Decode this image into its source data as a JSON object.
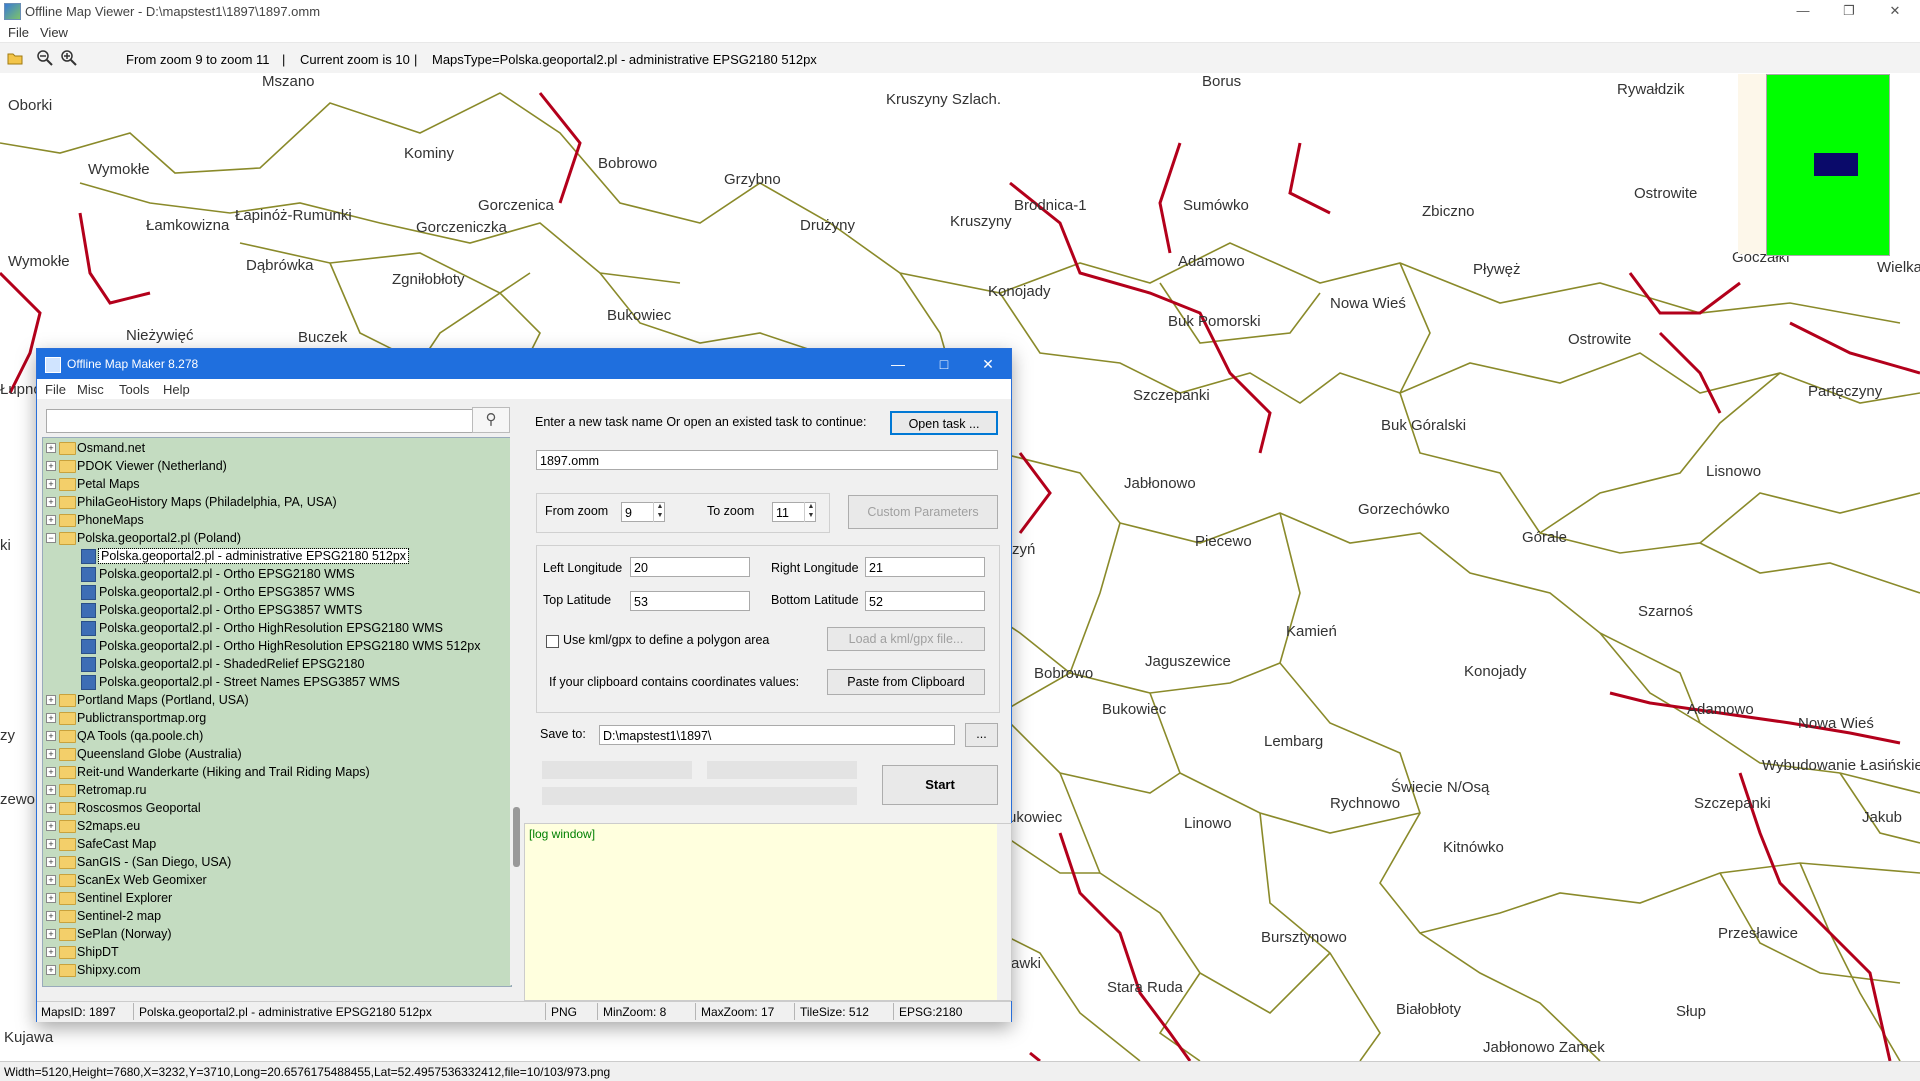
{
  "viewer": {
    "title": "Offline Map Viewer - D:\\mapstest1\\1897\\1897.omm",
    "menu": [
      "File",
      "View"
    ],
    "toolbar": {
      "zoom_range": "From zoom 9 to zoom 11",
      "current_zoom": "Current zoom is 10",
      "maps_type": "MapsType=Polska.geoportal2.pl - administrative EPSG2180 512px"
    },
    "status": "Width=5120,Height=7680,X=3232,Y=3710,Long=20.6576175488455,Lat=52.4957536332412,file=10/103/973.png"
  },
  "map": {
    "boundary_color": "#b3001b",
    "line_color": "#8a8a2a",
    "labels": [
      "Mszano",
      "Oborki",
      "Wymokłe",
      "Kominy",
      "Bobrowo",
      "Grzybno",
      "Kruszyny Szlach.",
      "Brodnica-1",
      "Kruszyny",
      "Drużyny",
      "Gorczenica",
      "Łapinóż-Rumunki",
      "Gorczeniczka",
      "Łamkowizna",
      "Wymokłe",
      "Dąbrówka",
      "Zgniłobłoty",
      "Bukowiec",
      "Konojady",
      "Nieżywięć",
      "Buczek",
      "Rywałdzik",
      "Ostrowite",
      "Sumówko",
      "Zbiczno",
      "Goczałki",
      "Wielka",
      "Adamowo",
      "Pływęż",
      "Nowa Wieś",
      "Buk Pomorski",
      "Ostrowite",
      "Szczepanki",
      "Buk Góralski",
      "Partęczyny",
      "Lisnowo",
      "Jabłonowo",
      "Gorzechówko",
      "Piecewo",
      "Górale",
      "Szarnoś",
      "Kamień",
      "Jaguszewice",
      "Konojady",
      "Bobrowo",
      "Bukowiec",
      "Lembarg",
      "Adamowo",
      "Nowa Wieś",
      "Wybudowanie Łasińskie",
      "Świecie N/Osą",
      "Rychnowo",
      "Szczepanki",
      "Linowo",
      "Kitnówko",
      "Jakub",
      "Bursztynowo",
      "Przesławice",
      "Stara Ruda",
      "Białobłoty",
      "Słup",
      "Jabłonowo Zamek",
      "Kujawa",
      "Łupno",
      "ki",
      "zy",
      "zewo",
      "zyń",
      "ukowiec",
      "awki",
      "Borus"
    ]
  },
  "dialog": {
    "title": "Offline Map Maker 8.278",
    "menu": [
      "File",
      "Misc",
      "Tools",
      "Help"
    ],
    "search_value": "",
    "tree": [
      {
        "label": "Osmand.net",
        "type": "folder"
      },
      {
        "label": "PDOK Viewer (Netherland)",
        "type": "folder"
      },
      {
        "label": "Petal Maps",
        "type": "folder"
      },
      {
        "label": "PhilaGeoHistory Maps (Philadelphia, PA, USA)",
        "type": "folder"
      },
      {
        "label": "PhoneMaps",
        "type": "folder"
      },
      {
        "label": "Polska.geoportal2.pl (Poland)",
        "type": "folder-open"
      },
      {
        "label": "Polska.geoportal2.pl - administrative EPSG2180 512px",
        "type": "map",
        "selected": true
      },
      {
        "label": "Polska.geoportal2.pl - Ortho EPSG2180 WMS",
        "type": "map"
      },
      {
        "label": "Polska.geoportal2.pl - Ortho EPSG3857 WMS",
        "type": "map"
      },
      {
        "label": "Polska.geoportal2.pl - Ortho EPSG3857 WMTS",
        "type": "map"
      },
      {
        "label": "Polska.geoportal2.pl - Ortho HighResolution EPSG2180 WMS",
        "type": "map"
      },
      {
        "label": "Polska.geoportal2.pl - Ortho HighResolution EPSG2180 WMS 512px",
        "type": "map"
      },
      {
        "label": "Polska.geoportal2.pl - ShadedRelief EPSG2180",
        "type": "map"
      },
      {
        "label": "Polska.geoportal2.pl - Street Names EPSG3857 WMS",
        "type": "map"
      },
      {
        "label": "Portland Maps (Portland, USA)",
        "type": "folder"
      },
      {
        "label": "Publictransportmap.org",
        "type": "folder"
      },
      {
        "label": "QA Tools (qa.poole.ch)",
        "type": "folder"
      },
      {
        "label": "Queensland Globe (Australia)",
        "type": "folder"
      },
      {
        "label": "Reit-und Wanderkarte (Hiking and Trail Riding Maps)",
        "type": "folder"
      },
      {
        "label": "Retromap.ru",
        "type": "folder"
      },
      {
        "label": "Roscosmos Geoportal",
        "type": "folder"
      },
      {
        "label": "S2maps.eu",
        "type": "folder"
      },
      {
        "label": "SafeCast Map",
        "type": "folder"
      },
      {
        "label": "SanGIS - (San Diego, USA)",
        "type": "folder"
      },
      {
        "label": "ScanEx Web Geomixer",
        "type": "folder"
      },
      {
        "label": "Sentinel Explorer",
        "type": "folder"
      },
      {
        "label": "Sentinel-2 map",
        "type": "folder"
      },
      {
        "label": "SePlan (Norway)",
        "type": "folder"
      },
      {
        "label": "ShipDT",
        "type": "folder"
      },
      {
        "label": "Shipxy.com",
        "type": "folder"
      }
    ],
    "task_prompt": "Enter a new task name Or open an existed task to continue:",
    "open_task": "Open task ...",
    "task_name": "1897.omm",
    "from_zoom_label": "From zoom",
    "from_zoom": "9",
    "to_zoom_label": "To zoom",
    "to_zoom": "11",
    "custom_params": "Custom Parameters",
    "left_lon_label": "Left Longitude",
    "left_lon": "20",
    "right_lon_label": "Right Longitude",
    "right_lon": "21",
    "top_lat_label": "Top Latitude",
    "top_lat": "53",
    "bottom_lat_label": "Bottom Latitude",
    "bottom_lat": "52",
    "kml_label": "Use kml/gpx to define a polygon area",
    "load_kml": "Load a kml/gpx file...",
    "clipboard_label": "If your clipboard contains coordinates values:",
    "paste_clipboard": "Paste from Clipboard",
    "save_to_label": "Save to:",
    "save_to": "D:\\mapstest1\\1897\\",
    "browse": "...",
    "start": "Start",
    "log_title": "[log window]",
    "status": {
      "maps_id": "MapsID: 1897",
      "map_name": "Polska.geoportal2.pl - administrative EPSG2180 512px",
      "format": "PNG",
      "min_zoom": "MinZoom: 8",
      "max_zoom": "MaxZoom: 17",
      "tile_size": "TileSize: 512",
      "epsg": "EPSG:2180"
    }
  }
}
